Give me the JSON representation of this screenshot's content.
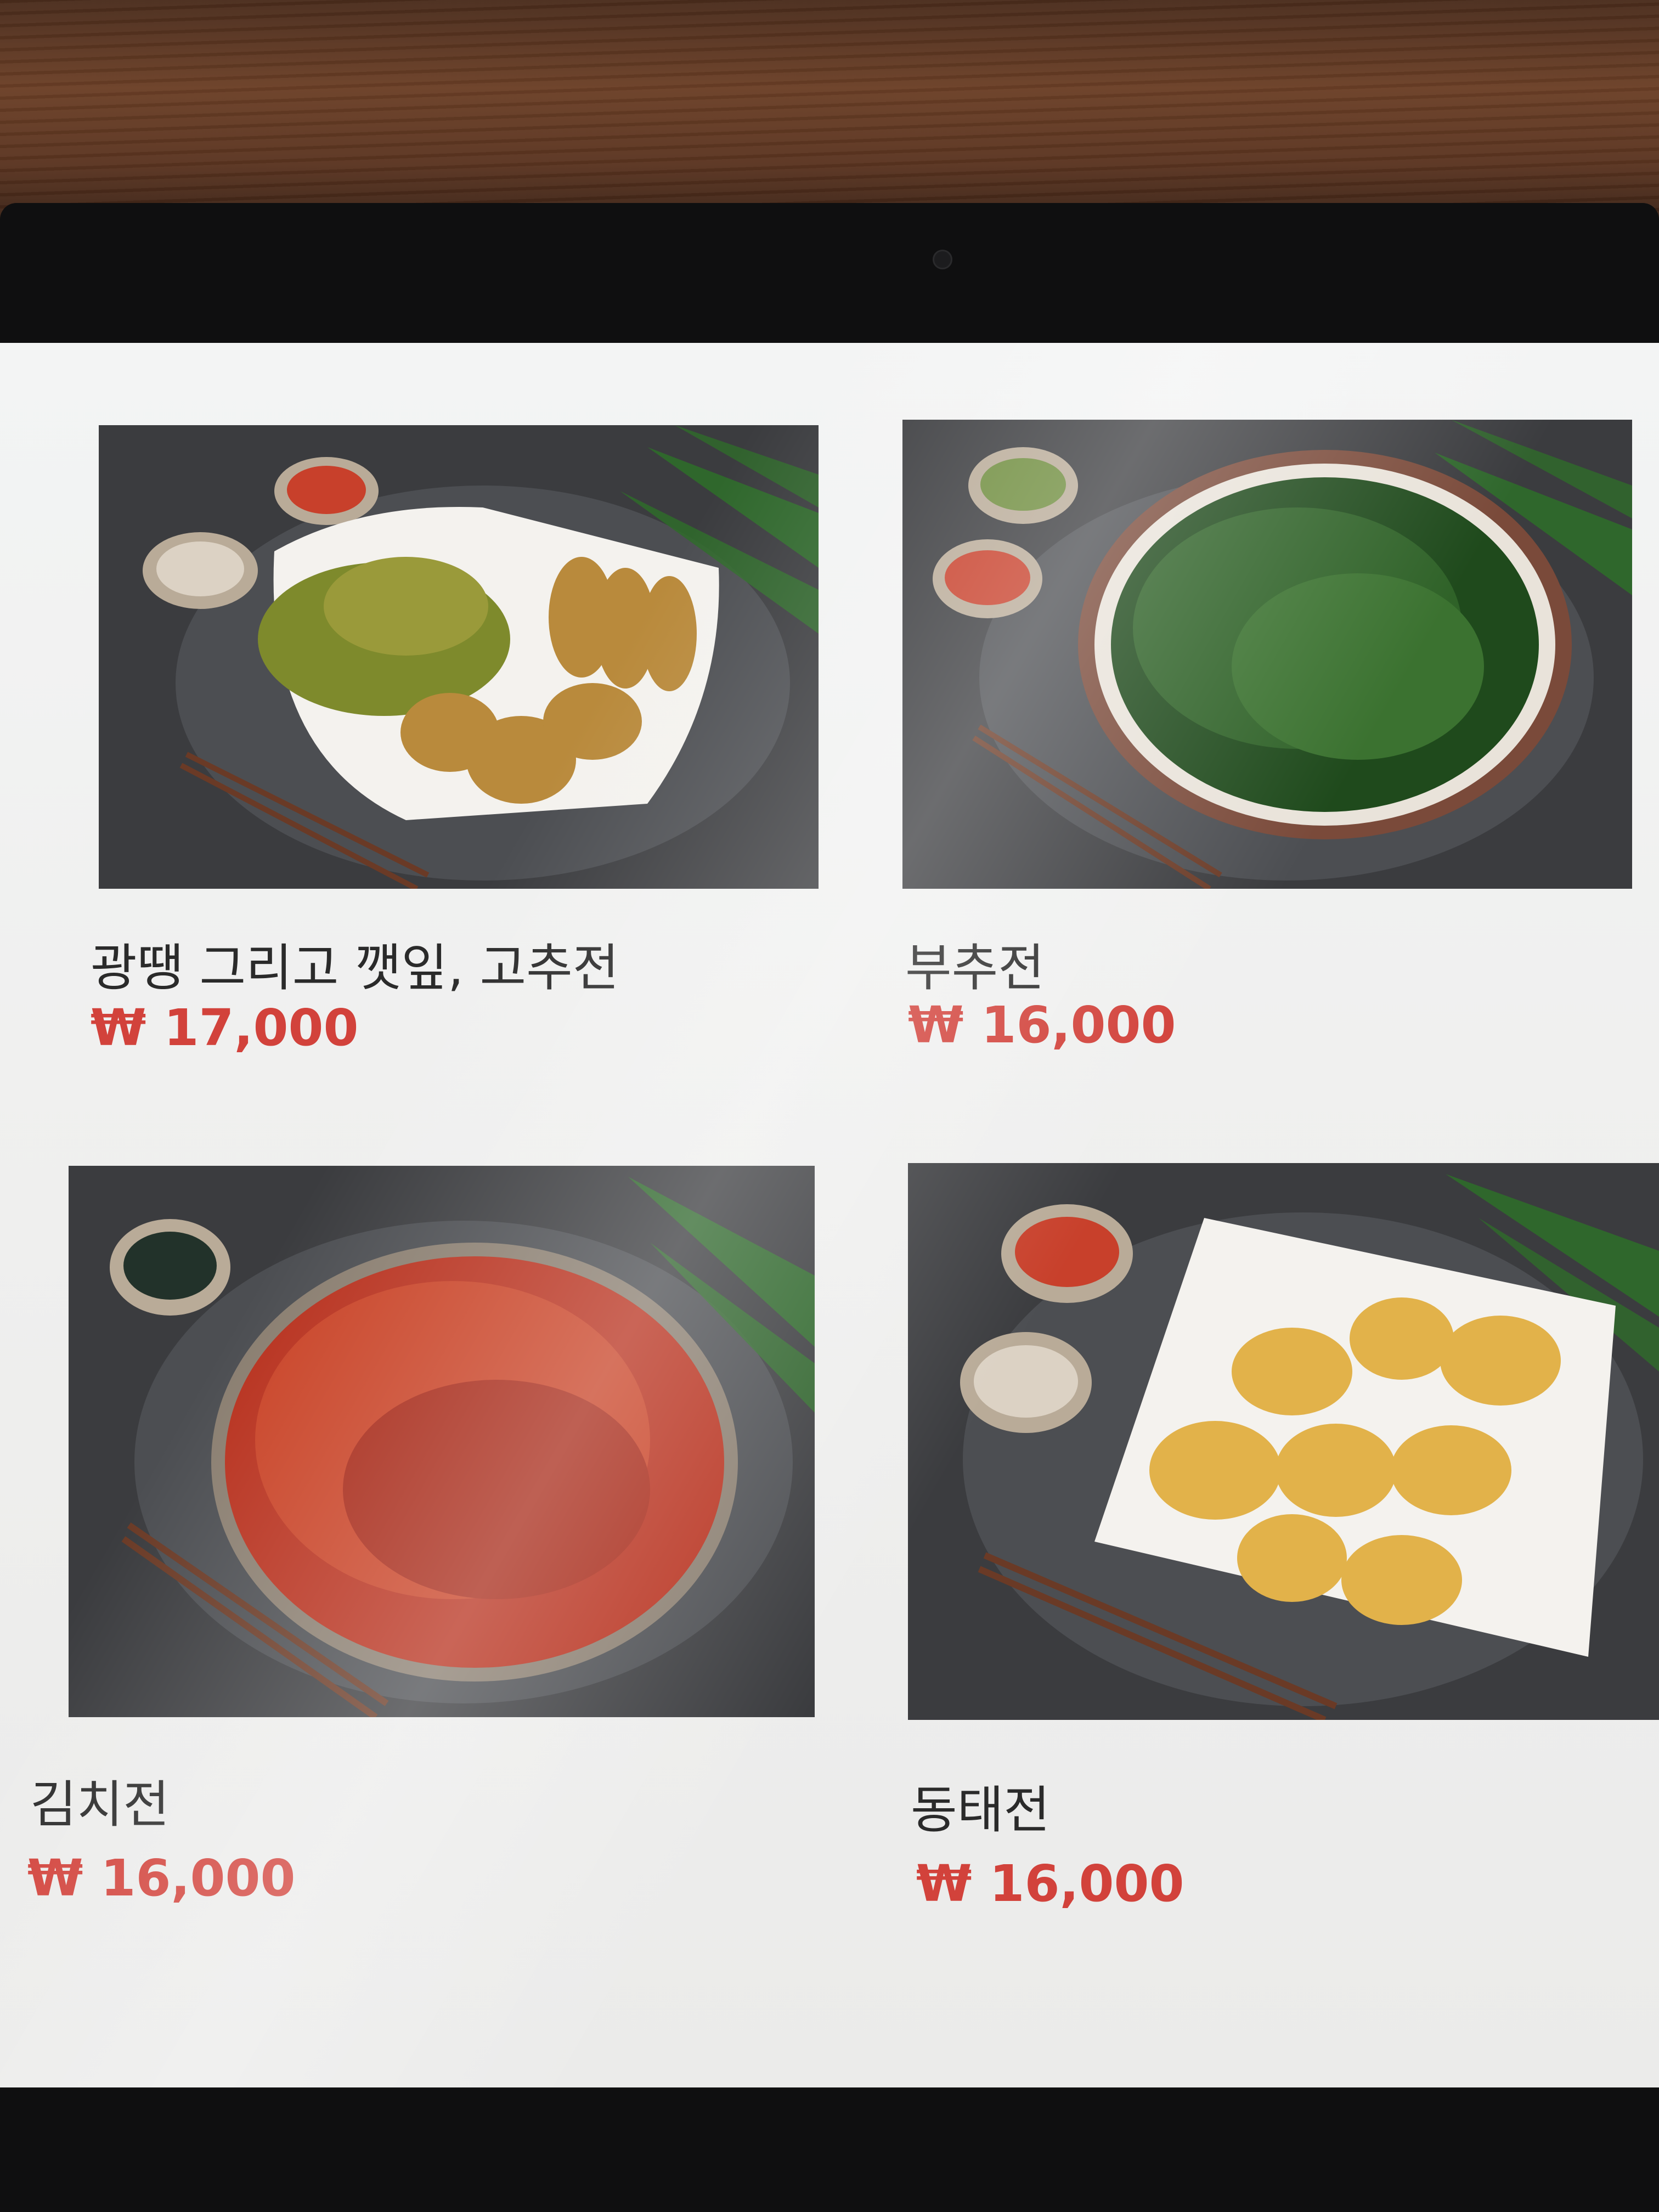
{
  "menu": {
    "items": [
      {
        "name": "광땡 그리고 깻잎, 고추전",
        "price": "₩ 17,000",
        "image_icon": "jeon-platter-photo"
      },
      {
        "name": "부추전",
        "price": "₩ 16,000",
        "image_icon": "chive-pancake-photo"
      },
      {
        "name": "김치전",
        "price": "₩ 16,000",
        "image_icon": "kimchi-pancake-photo"
      },
      {
        "name": "동태전",
        "price": "₩ 16,000",
        "image_icon": "pollock-jeon-photo"
      }
    ]
  },
  "colors": {
    "price": "#d2423b",
    "name": "#2a2a2a",
    "screen_bg": "#f0f0ef",
    "photo_bg": "#3c3d40"
  }
}
